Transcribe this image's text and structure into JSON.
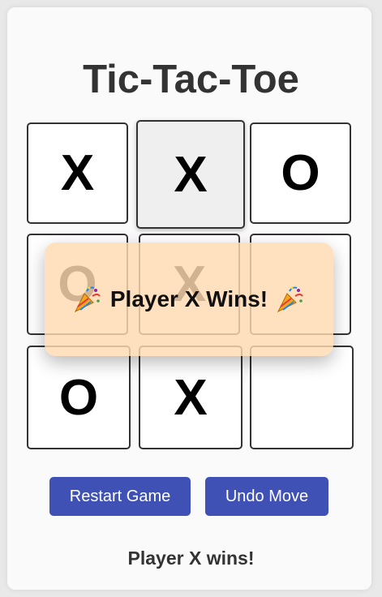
{
  "title": "Tic-Tac-Toe",
  "board": {
    "cells": [
      "X",
      "X",
      "O",
      "O",
      "X",
      "",
      "O",
      "X",
      ""
    ]
  },
  "overlay": {
    "message": "Player X Wins!",
    "icon_left": "party-popper-icon",
    "icon_right": "party-popper-icon"
  },
  "buttons": {
    "restart_label": "Restart Game",
    "undo_label": "Undo Move"
  },
  "status": "Player X wins!",
  "colors": {
    "button_bg": "#3f51b5",
    "overlay_bg": "#ffdab2",
    "text_dark": "#333333"
  }
}
